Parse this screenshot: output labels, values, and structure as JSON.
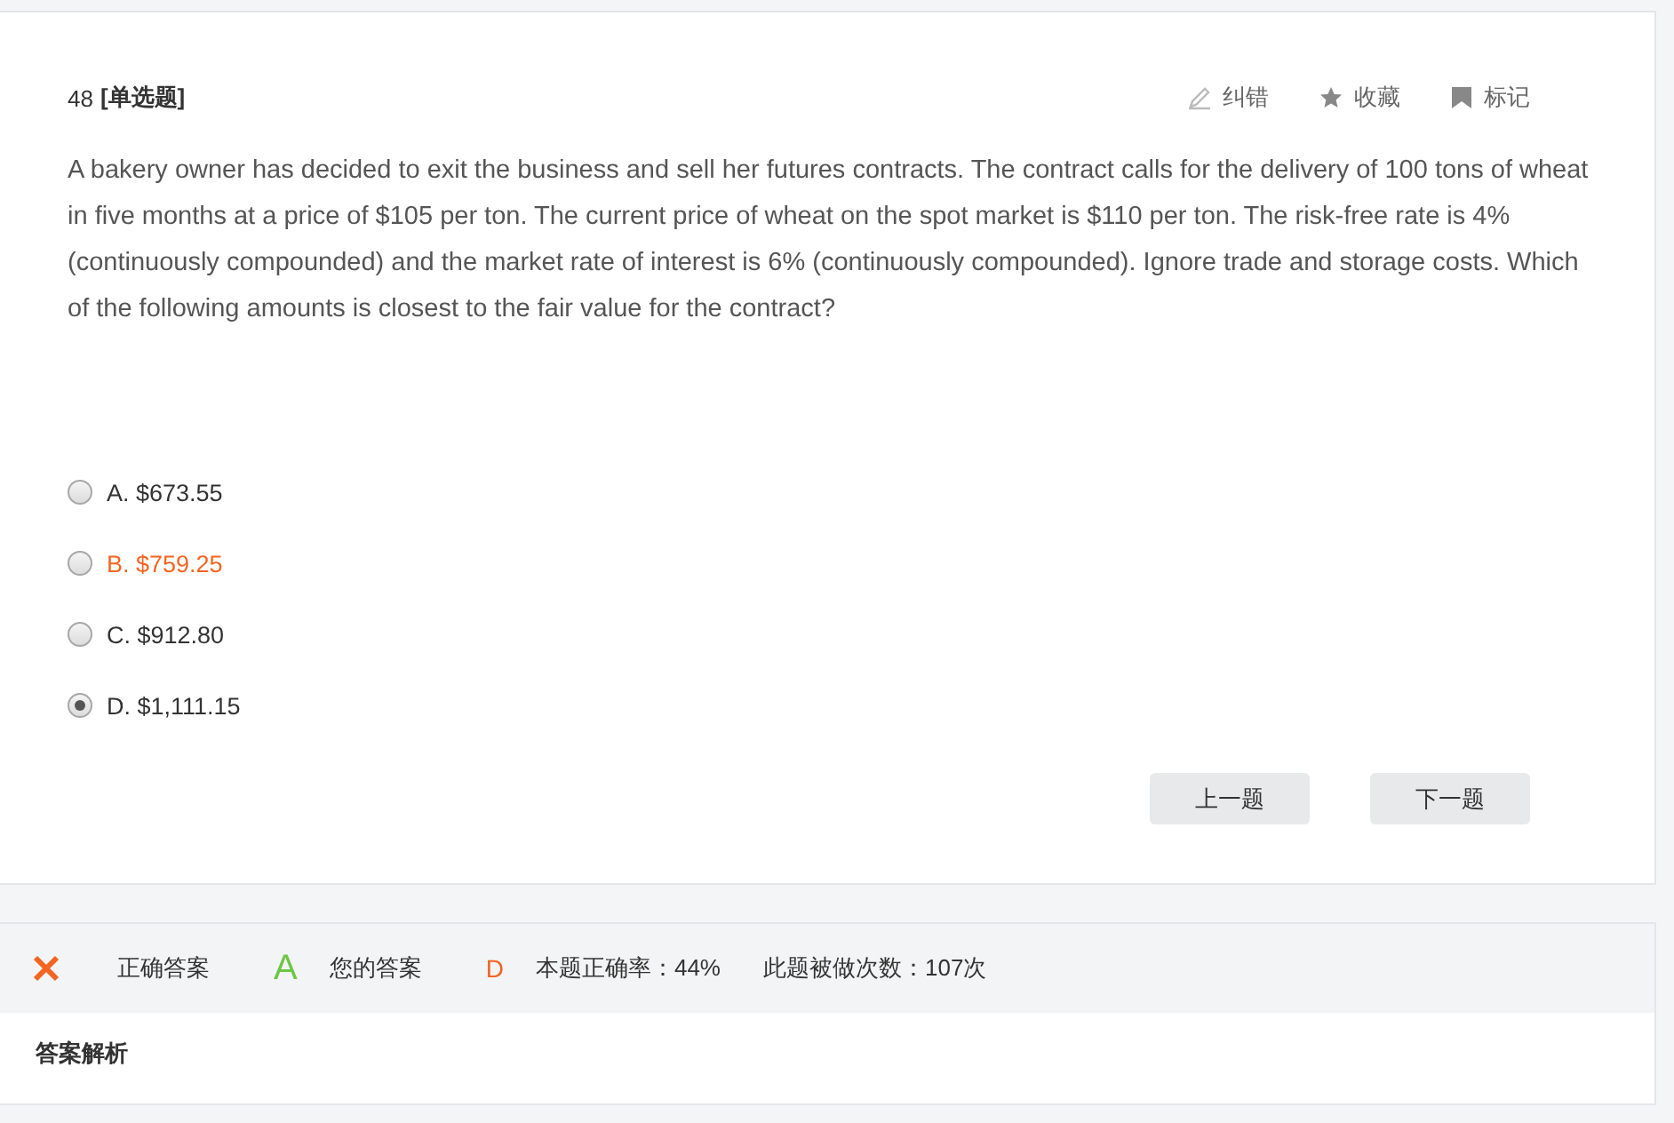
{
  "question": {
    "number": "48",
    "type": "[单选题]",
    "actions": [
      {
        "kind": "edit",
        "label": "纠错"
      },
      {
        "kind": "star",
        "label": "收藏"
      },
      {
        "kind": "flag",
        "label": "标记"
      }
    ],
    "text": "A bakery owner has decided to exit the business and sell her futures contracts. The contract calls for the delivery of 100 tons of wheat in five months at a price of $105 per ton. The current price of wheat on the spot market is $110 per ton. The risk-free rate is 4% (continuously compounded) and the market rate of interest is 6% (continuously compounded). Ignore trade and storage costs. Which of the following amounts is closest to the fair value for the contract?",
    "options": [
      {
        "label": "A. $673.55",
        "selected": false,
        "highlighted": false
      },
      {
        "label": "B. $759.25",
        "selected": false,
        "highlighted": true
      },
      {
        "label": "C. $912.80",
        "selected": false,
        "highlighted": false
      },
      {
        "label": "D. $1,111.15",
        "selected": true,
        "highlighted": false
      }
    ],
    "buttons": [
      "上一题",
      "下一题"
    ]
  },
  "result": {
    "correct": false,
    "correct_label": "正确答案",
    "correct_answer": "A",
    "your_label": "您的答案",
    "your_answer": "D",
    "accuracy": "本题正确率：44%",
    "attempts": "此题被做次数：107次"
  },
  "analysis": {
    "title": "答案解析"
  }
}
